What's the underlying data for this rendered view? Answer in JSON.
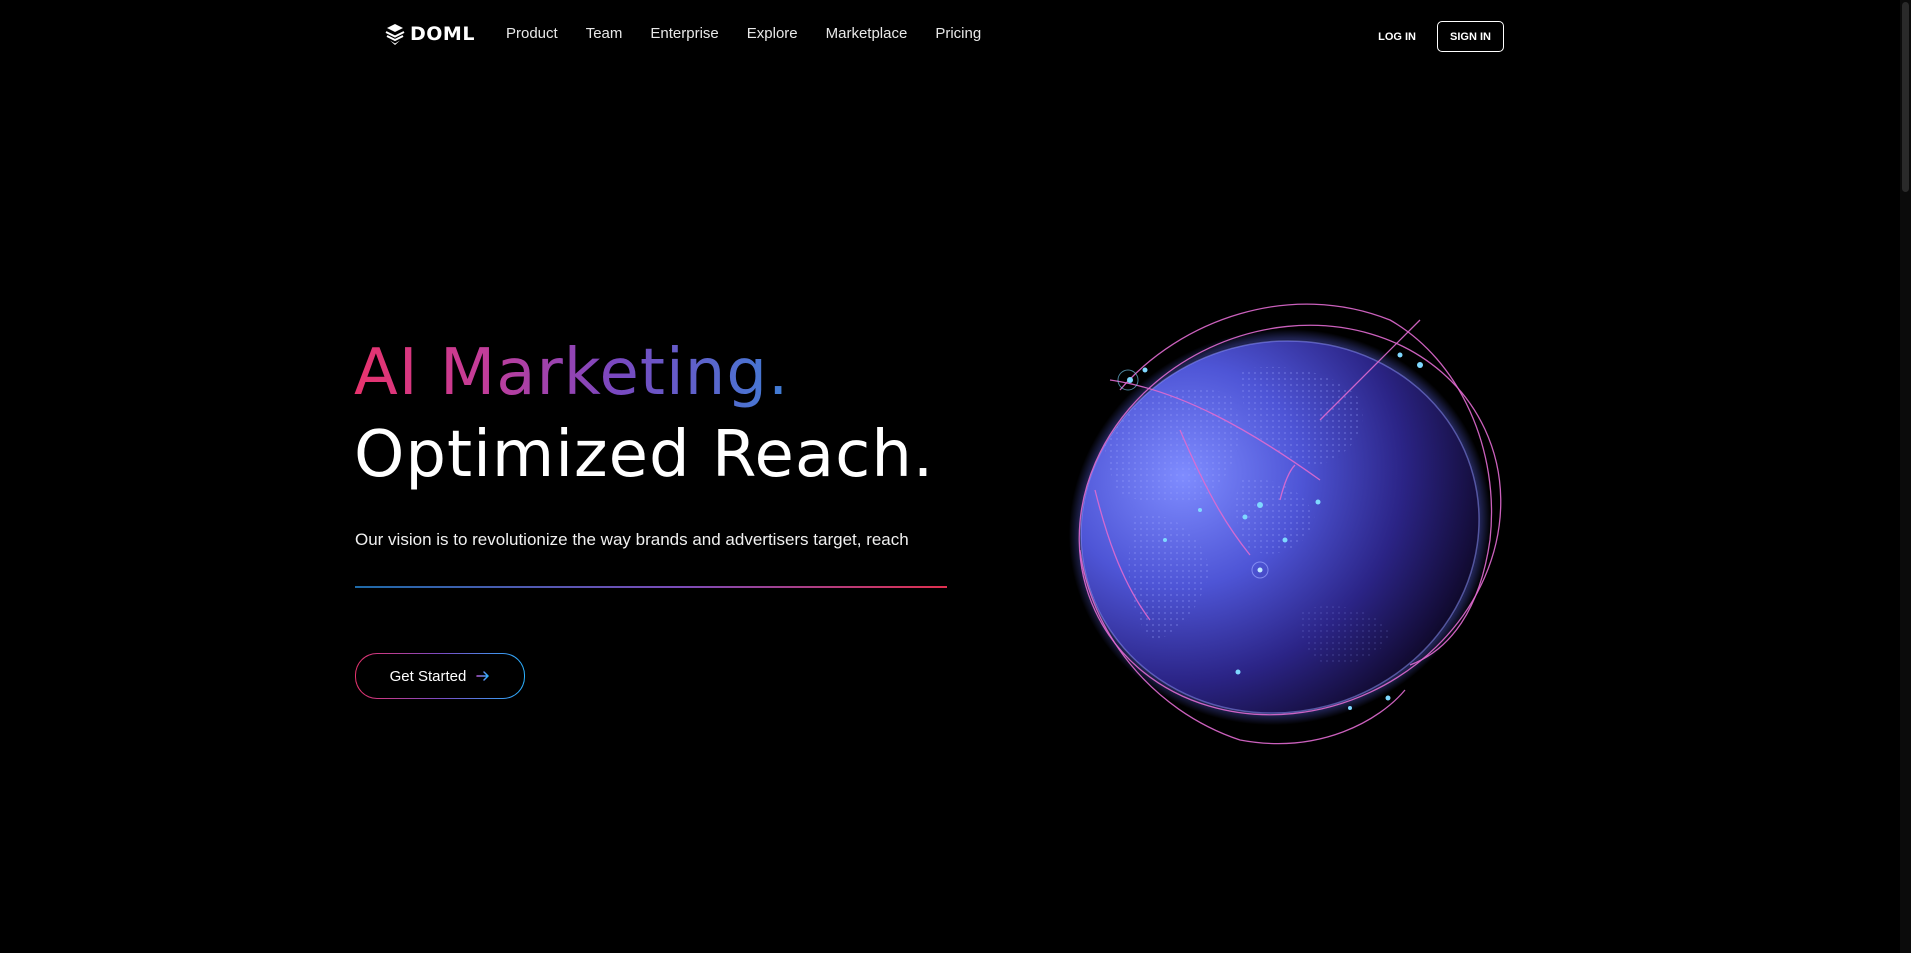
{
  "header": {
    "logo_text": "DOML",
    "nav": [
      "Product",
      "Team",
      "Enterprise",
      "Explore",
      "Marketplace",
      "Pricing"
    ],
    "login_label": "LOG IN",
    "signin_label": "SIGN IN"
  },
  "hero": {
    "title_line1": "AI Marketing.",
    "title_line2": "Optimized Reach.",
    "subtitle": "Our vision is to revolutionize the way brands and advertisers target, reach",
    "cta_label": "Get Started"
  },
  "colors": {
    "background": "#000000",
    "accent_pink": "#e8336d",
    "accent_purple": "#7a48c0",
    "accent_blue": "#3f7ed6",
    "globe_blue": "#5a63e8"
  },
  "icons": {
    "logo": "logo-mark-icon",
    "cta": "arrow-right-icon"
  }
}
